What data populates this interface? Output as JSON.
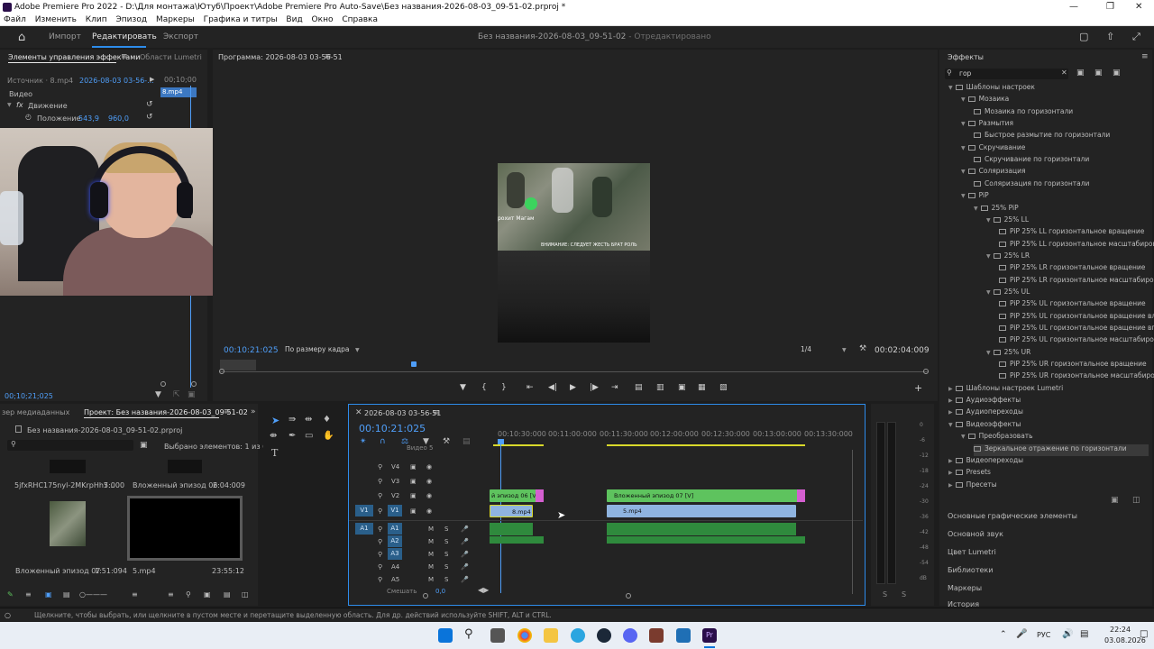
{
  "window": {
    "title": "Adobe Premiere Pro 2022 - D:\\Для монтажа\\Ютуб\\Проект\\Adobe Premiere Pro Auto-Save\\Без названия-2026-08-03_09-51-02.prproj *"
  },
  "menu": [
    "Файл",
    "Изменить",
    "Клип",
    "Эпизод",
    "Маркеры",
    "Графика и титры",
    "Вид",
    "Окно",
    "Справка"
  ],
  "workspace": {
    "tabs": [
      "Импорт",
      "Редактировать",
      "Экспорт"
    ],
    "active": "Редактировать",
    "project_title": "Без названия-2026-08-03_09-51-02",
    "project_status": "- Отредактировано"
  },
  "effect_controls": {
    "tab_label": "Элементы управления эффектами",
    "tab2_label": "Области Lumetri",
    "source_label": "Источник · 8.mp4",
    "sequence_label": "2026-08-03 03-56-...",
    "time_top": "00;10;00",
    "clip_chip": "8.mp4",
    "video_label": "Видео",
    "motion_label": "Движение",
    "position_label": "Положение",
    "position_x": "543,9",
    "position_y": "960,0",
    "timecode": "00;10;21;025"
  },
  "program": {
    "tab_label": "Программа: 2026-08-03 03-56-51",
    "timecode": "00:10:21:025",
    "fit": "По размеру кадра",
    "quality": "1/4",
    "duration": "00:02:04:009",
    "overlay_name": "рохит Магам",
    "overlay_caption": "ВНИМАНИЕ: СЛЕДУЕТ ЖЕСТЬ БРАТ РОЛЬ"
  },
  "project": {
    "tab1": "зер медиаданных",
    "tab2": "Проект: Без названия-2026-08-03_09-51-02",
    "file_name": "Без названия-2026-08-03_09-51-02.prproj",
    "selected": "Выбрано элементов: 1 из 64",
    "items": [
      {
        "name": "5jfxRHC175nyl-2MKrpHh7...",
        "duration": "5:000"
      },
      {
        "name": "Вложенный эпизод 06",
        "duration": "2:04:009"
      },
      {
        "name": "Вложенный эпизод 07",
        "duration": "1:51:094"
      },
      {
        "name": "5.mp4",
        "duration": "23:55:12"
      }
    ]
  },
  "timeline": {
    "tab_label": "2026-08-03 03-56-51",
    "timecode": "00:10:21:025",
    "ruler": [
      "00:10:30:000",
      "00:11:00:000",
      "00:11:30:000",
      "00:12:00:000",
      "00:12:30:000",
      "00:13:00:000",
      "00:13:30:000"
    ],
    "video_header": "Видео 5",
    "tracks_v": [
      "V4",
      "V3",
      "V2",
      "V1"
    ],
    "tracks_a": [
      "A1",
      "A2",
      "A3",
      "A4",
      "A5"
    ],
    "v1_src": "V1",
    "a1_src": "A1",
    "mix_label": "Смешать",
    "mix_value": "0,0",
    "clips": {
      "v2_left": "й эпизод 06 [V]",
      "v2_right": "Вложенный эпизод 07 [V]",
      "v1_left": "8.mp4",
      "v1_right": "5.mp4"
    }
  },
  "meter": {
    "ticks": [
      "0",
      "-6",
      "-12",
      "-18",
      "-24",
      "-30",
      "-36",
      "-42",
      "-48",
      "-54",
      "dB"
    ],
    "solo1": "S",
    "solo2": "S"
  },
  "effects": {
    "tab_label": "Эффекты",
    "search": "гор",
    "tree": [
      {
        "lvl": 0,
        "t": "Шаблоны настроек",
        "folder": true
      },
      {
        "lvl": 1,
        "t": "Мозаика",
        "folder": true
      },
      {
        "lvl": 2,
        "t": "Мозаика по горизонтали",
        "folder": false
      },
      {
        "lvl": 1,
        "t": "Размытия",
        "folder": true
      },
      {
        "lvl": 2,
        "t": "Быстрое размытие по горизонтали",
        "folder": false
      },
      {
        "lvl": 1,
        "t": "Скручивание",
        "folder": true
      },
      {
        "lvl": 2,
        "t": "Скручивание по горизонтали",
        "folder": false
      },
      {
        "lvl": 1,
        "t": "Соляризация",
        "folder": true
      },
      {
        "lvl": 2,
        "t": "Соляризация по горизонтали",
        "folder": false
      },
      {
        "lvl": 1,
        "t": "PiP",
        "folder": true
      },
      {
        "lvl": 2,
        "t": "25% PiP",
        "folder": true
      },
      {
        "lvl": 3,
        "t": "25% LL",
        "folder": true
      },
      {
        "lvl": 4,
        "t": "PiP 25% LL горизонтальное вращение",
        "folder": false
      },
      {
        "lvl": 4,
        "t": "PiP 25% LL горизонтальное масштабирование",
        "folder": false
      },
      {
        "lvl": 3,
        "t": "25% LR",
        "folder": true
      },
      {
        "lvl": 4,
        "t": "PiP 25% LR горизонтальное вращение",
        "folder": false
      },
      {
        "lvl": 4,
        "t": "PiP 25% LR горизонтальное масштабирование",
        "folder": false
      },
      {
        "lvl": 3,
        "t": "25% UL",
        "folder": true
      },
      {
        "lvl": 4,
        "t": "PiP 25% UL горизонтальное вращение",
        "folder": false
      },
      {
        "lvl": 4,
        "t": "PiP 25% UL горизонтальное вращение влево",
        "folder": false
      },
      {
        "lvl": 4,
        "t": "PiP 25% UL горизонтальное вращение вправо",
        "folder": false
      },
      {
        "lvl": 4,
        "t": "PiP 25% UL горизонтальное масштабирование",
        "folder": false
      },
      {
        "lvl": 3,
        "t": "25% UR",
        "folder": true
      },
      {
        "lvl": 4,
        "t": "PiP 25% UR горизонтальное вращение",
        "folder": false
      },
      {
        "lvl": 4,
        "t": "PiP 25% UR горизонтальное масштабирование",
        "folder": false
      },
      {
        "lvl": 0,
        "t": "Шаблоны настроек Lumetri",
        "folder": true
      },
      {
        "lvl": 0,
        "t": "Аудиоэффекты",
        "folder": true
      },
      {
        "lvl": 0,
        "t": "Аудиопереходы",
        "folder": true
      },
      {
        "lvl": 0,
        "t": "Видеоэффекты",
        "folder": true
      },
      {
        "lvl": 1,
        "t": "Преобразовать",
        "folder": true
      },
      {
        "lvl": 2,
        "t": "Зеркальное отражение по горизонтали",
        "folder": false,
        "selected": true
      },
      {
        "lvl": 0,
        "t": "Видеопереходы",
        "folder": true
      },
      {
        "lvl": 0,
        "t": "Presets",
        "folder": true
      },
      {
        "lvl": 0,
        "t": "Пресеты",
        "folder": true
      }
    ],
    "sections": [
      "Основные графические элементы",
      "Основной звук",
      "Цвет Lumetri",
      "Библиотеки",
      "Маркеры",
      "История"
    ]
  },
  "status": {
    "hint": "Щелкните, чтобы выбрать, или щелкните в пустом месте и перетащите выделенную область. Для др. действий используйте SHIFT, ALT и CTRL."
  },
  "taskbar": {
    "lang": "РУС",
    "time": "22:24",
    "date": "03.08.2026"
  },
  "colors": {
    "accent": "#2d8ceb",
    "clip_video": "#5ec35e",
    "clip_blue": "#8fb4e0",
    "clip_pink": "#d45fd0",
    "audio_green": "#2f8a3d",
    "playhead": "#4f9ef8"
  }
}
